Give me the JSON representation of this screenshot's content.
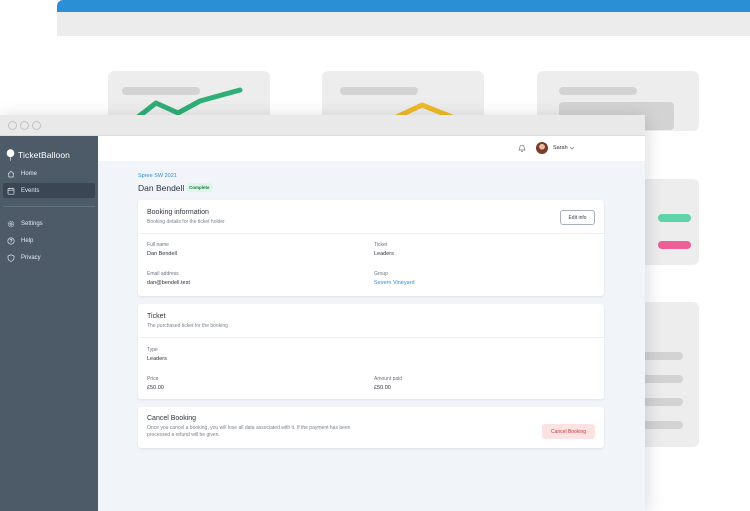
{
  "brand": {
    "name": "TicketBalloon"
  },
  "sidebar": {
    "items": [
      {
        "label": "Home",
        "icon": "home-icon"
      },
      {
        "label": "Events",
        "icon": "calendar-icon",
        "active": true
      },
      {
        "label": "Settings",
        "icon": "gear-icon"
      },
      {
        "label": "Help",
        "icon": "help-icon"
      },
      {
        "label": "Privacy",
        "icon": "shield-icon"
      }
    ]
  },
  "topbar": {
    "user": "Sarah"
  },
  "header": {
    "event": "Spree SW 2021",
    "booking_name": "Dan Bendell",
    "status": "Complete"
  },
  "booking_info": {
    "title": "Booking information",
    "subtitle": "Booking details for the ticket holder",
    "edit_label": "Edit info",
    "fields": {
      "full_name_label": "Full name",
      "full_name": "Dan Bendell",
      "ticket_label": "Ticket",
      "ticket": "Leaders",
      "email_label": "Email address",
      "email": "dan@bendell.test",
      "group_label": "Group",
      "group": "Severn Vineyard"
    }
  },
  "ticket": {
    "title": "Ticket",
    "subtitle": "The purchased ticket for the booking",
    "type_label": "Type",
    "type": "Leaders",
    "price_label": "Price",
    "price": "£50.00",
    "paid_label": "Amount paid",
    "paid": "£50.00"
  },
  "cancel": {
    "title": "Cancel Booking",
    "description_line1": "Once you cancel a booking, you will lose all data associated with it. If the payment has been",
    "description_line2": "processed a refund will be given.",
    "button_label": "Cancel Booking"
  },
  "colors": {
    "accent": "#2b8fd6",
    "sidebar": "#4d5b69",
    "danger": "#c43d3d",
    "success": "#1e7a45"
  }
}
